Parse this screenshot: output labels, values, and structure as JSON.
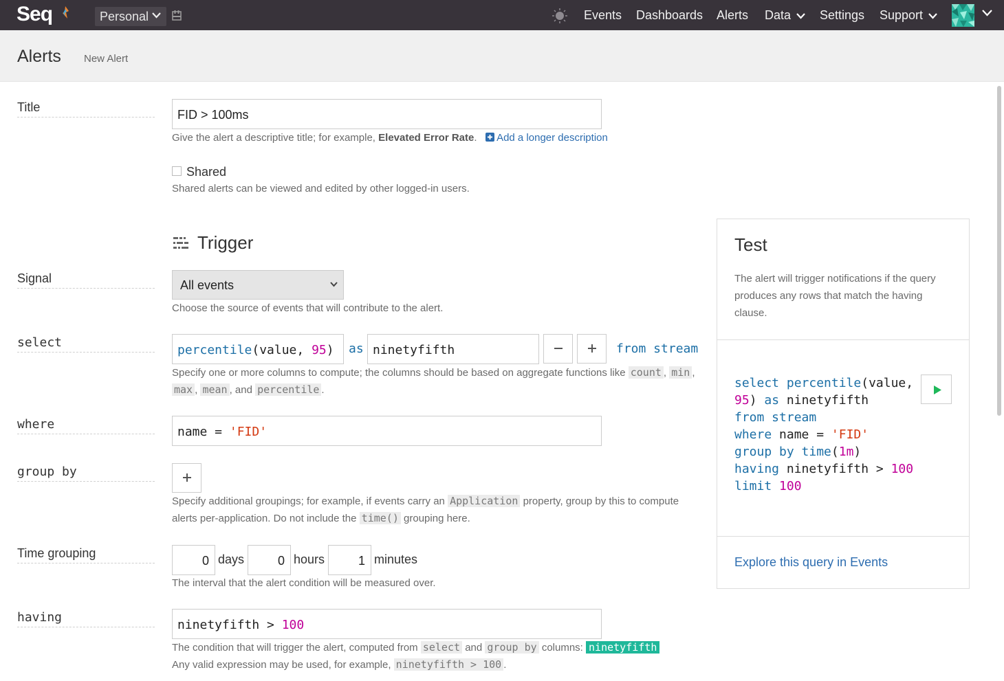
{
  "nav": {
    "logo": "Seq",
    "workspace": "Personal",
    "links": [
      "Events",
      "Dashboards",
      "Alerts",
      "Data",
      "Settings",
      "Support"
    ]
  },
  "header": {
    "title": "Alerts",
    "subtitle": "New Alert"
  },
  "form": {
    "title_label": "Title",
    "title_value": "FID > 100ms",
    "title_help_prefix": "Give the alert a descriptive title; for example,",
    "title_help_example": "Elevated Error Rate",
    "title_help_suffix": ".",
    "add_description": "Add a longer description",
    "shared_label": "Shared",
    "shared_help": "Shared alerts can be viewed and edited by other logged-in users.",
    "trigger_heading": "Trigger",
    "signal_label": "Signal",
    "signal_value": "All events",
    "signal_help": "Choose the source of events that will contribute to the alert.",
    "select_label": "select",
    "select_fn": "percentile",
    "select_open": "(value, ",
    "select_num": "95",
    "select_close": ")",
    "as": "as",
    "alias": "ninetyfifth",
    "from_stream": "from stream",
    "select_help_1": "Specify one or more columns to compute; the columns should be based on aggregate functions like",
    "select_help_count": "count",
    "select_help_min": "min",
    "select_help_max": "max",
    "select_help_mean": "mean",
    "select_help_and": ", and",
    "select_help_percentile": "percentile",
    "where_label": "where",
    "where_lhs": "name = ",
    "where_str": "'FID'",
    "groupby_label": "group by",
    "groupby_help_1": "Specify additional groupings; for example, if events carry an",
    "groupby_help_app": "Application",
    "groupby_help_2": "property, group by this to compute",
    "groupby_help_3": "alerts per-application. Do not include the",
    "groupby_help_time": "time()",
    "groupby_help_4": "grouping here.",
    "timegroup_label": "Time grouping",
    "days_value": "0",
    "days_unit": "days",
    "hours_value": "0",
    "hours_unit": "hours",
    "minutes_value": "1",
    "minutes_unit": "minutes",
    "timegroup_help": "The interval that the alert condition will be measured over.",
    "having_label": "having",
    "having_lhs": "ninetyfifth > ",
    "having_num": "100",
    "having_help_1": "The condition that will trigger the alert, computed from",
    "having_help_select": "select",
    "having_help_and": "and",
    "having_help_groupby": "group by",
    "having_help_cols": "columns:",
    "having_help_tag": "ninetyfifth",
    "having_help_2": "Any valid expression may be used, for example,",
    "having_help_example": "ninetyfifth > 100",
    "having_help_end": "."
  },
  "test": {
    "title": "Test",
    "description": "The alert will trigger notifications if the query produces any rows that match the having clause.",
    "explore": "Explore this query in Events"
  },
  "colors": {
    "nav_bg": "#38333a",
    "keyword": "#1c6fa6",
    "number": "#c00098",
    "string": "#d43a12",
    "tag": "#1fb89a",
    "link": "#2d6db0"
  }
}
